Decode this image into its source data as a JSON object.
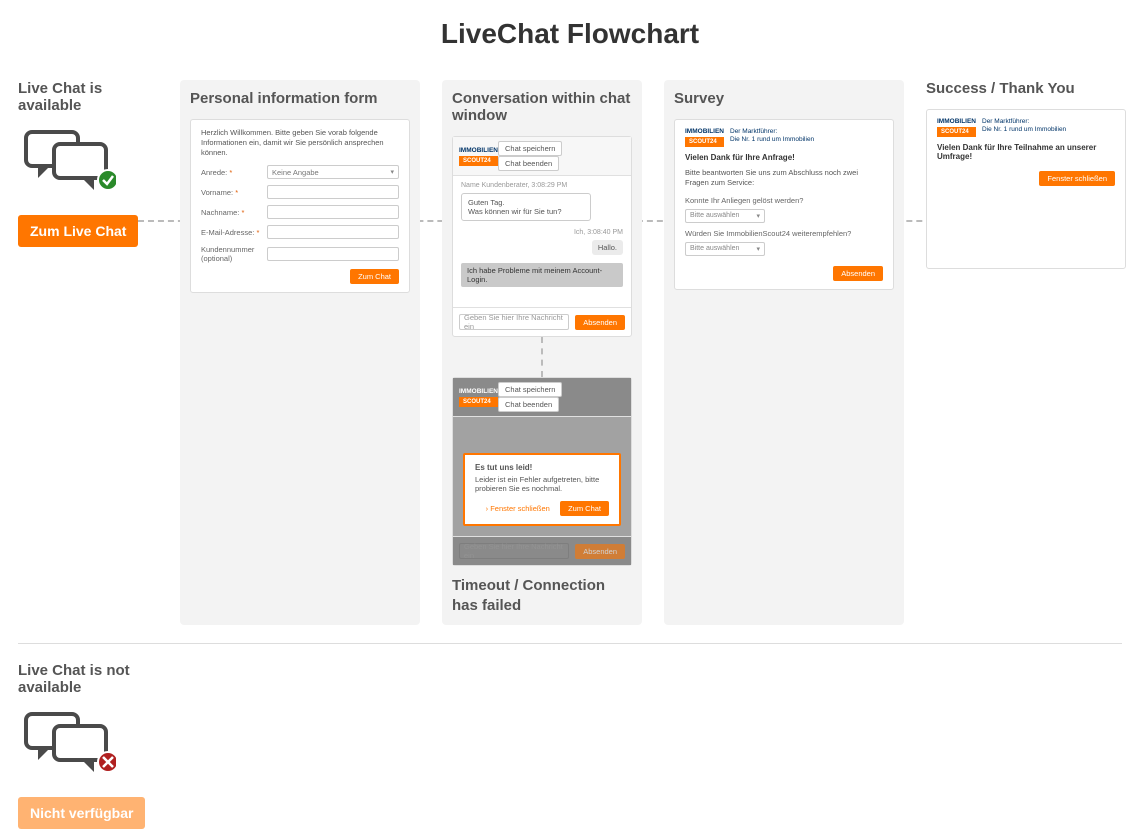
{
  "title": "LiveChat Flowchart",
  "accent": "#ff7600",
  "available": {
    "label": "Live Chat is available",
    "cta": "Zum Live Chat"
  },
  "unavailable": {
    "label": "Live Chat is not available",
    "cta": "Nicht verfügbar"
  },
  "form": {
    "label": "Personal information form",
    "intro": "Herzlich Willkommen. Bitte geben Sie vorab folgende Informationen ein, damit wir Sie persönlich ansprechen können.",
    "fields": {
      "salutation": {
        "label": "Anrede:",
        "value": "Keine Angabe"
      },
      "firstname": {
        "label": "Vorname:"
      },
      "lastname": {
        "label": "Nachname:"
      },
      "email": {
        "label": "E-Mail-Adresse:"
      },
      "customerNo": {
        "label": "Kundennummer (optional)"
      }
    },
    "submit": "Zum Chat"
  },
  "conversation": {
    "label": "Conversation within chat window",
    "brand": {
      "name": "IMMOBILIEN",
      "tag": "SCOUT24"
    },
    "header_buttons": {
      "save": "Chat speichern",
      "end": "Chat beenden"
    },
    "agent_meta": "Name Kundenberater, 3:08:29 PM",
    "agent_lines": [
      "Guten Tag.",
      "Was können wir für Sie tun?"
    ],
    "user_meta": "Ich, 3:08:40 PM",
    "user_msg": "Hallo.",
    "suggestion": "Ich habe Probleme mit meinem Account-Login.",
    "composer_placeholder": "Geben Sie hier Ihre Nachricht ein",
    "send": "Absenden"
  },
  "timeout": {
    "label": "Timeout / Connection has failed",
    "modal_title": "Es tut uns leid!",
    "modal_body": "Leider ist ein Fehler aufgetreten, bitte probieren Sie es nochmal.",
    "close_link": "› Fenster schließen",
    "retry": "Zum Chat"
  },
  "survey": {
    "label": "Survey",
    "brand_tagline1": "Der Marktführer:",
    "brand_tagline2": "Die Nr. 1 rund um Immobilien",
    "title": "Vielen Dank für Ihre Anfrage!",
    "sub": "Bitte beantworten Sie uns zum Abschluss noch zwei Fragen zum Service:",
    "q1": "Konnte Ihr Anliegen gelöst werden?",
    "q2": "Würden Sie ImmobilienScout24 weiterempfehlen?",
    "select_placeholder": "Bitte auswählen",
    "submit": "Absenden"
  },
  "thanks": {
    "label": "Success / Thank You",
    "title": "Vielen Dank für Ihre Teilnahme an unserer Umfrage!",
    "close": "Fenster schließen"
  }
}
